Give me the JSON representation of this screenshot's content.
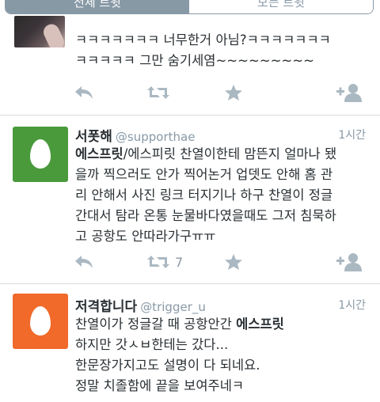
{
  "colors": {
    "tab_active": "#8899a6",
    "avatar_green": "#4a9a3c",
    "avatar_orange": "#f16a2a",
    "action_gray": "#aab8c2"
  },
  "tabs": [
    {
      "label": "전체 트윗",
      "active": true
    },
    {
      "label": "모든 트윗",
      "active": false
    }
  ],
  "tweets": [
    {
      "name": "",
      "handle": "",
      "time": "",
      "text_lines": [
        "ㅋㅋㅋㅋㅋㅋㅋ 너무한거 아님?ㅋㅋㅋㅋㅋㅋㅋ",
        "ㅋㅋㅋㅋㅋ 그만 숨기세염~~~~~~~~~"
      ],
      "retweets": ""
    },
    {
      "name": "서폿해",
      "handle": "@supporthae",
      "time": "1시간",
      "text_first_bold": "에스프릿",
      "text_first_rest": "/에스피릿 찬열이한테 맘뜬지 얼마나 됐",
      "text_lines": [
        "을까 찍으러도 안가 찍어논거 업뎃도 안해 홈 관",
        "리 안해서 사진 링크 터지기나 하구 찬열이 정글",
        "간대서 탐라 온통 눈물바다였을때도 그저 침묵하",
        "고 공항도 안따라가구ㅠㅠ"
      ],
      "retweets": "7"
    },
    {
      "name": "저격합니다",
      "handle": "@trigger_u",
      "time": "1시간",
      "text_first_plain": "찬열이가 정글갈 때 공항안간 ",
      "text_first_bold": "에스프릿",
      "text_lines": [
        "하지만 갓ㅅㅂ한테는 갔다...",
        "한문장가지고도 설명이 다 되네요.",
        "정말 치졸함에 끝을 보여주네ㅋ"
      ]
    }
  ],
  "icons": {
    "reply": "reply-icon",
    "retweet": "retweet-icon",
    "favorite": "star-icon",
    "follow": "follow-icon"
  }
}
